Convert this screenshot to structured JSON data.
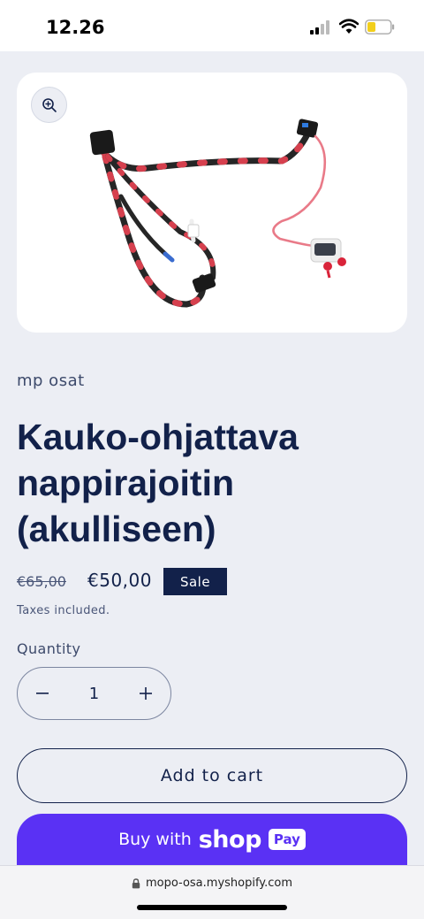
{
  "status_bar": {
    "time": "12.26",
    "icons": [
      "signal-icon",
      "wifi-icon",
      "battery-icon"
    ]
  },
  "product": {
    "image_alt": "Kauko-ohjattava nappirajoitin (akulliseen)",
    "zoom_icon": "zoom-in-icon",
    "vendor": "mp osat",
    "title": "Kauko-ohjattava nappirajoitin (akulliseen)",
    "price_compare": "€65,00",
    "price_sale": "€50,00",
    "sale_badge": "Sale",
    "taxes_note": "Taxes included."
  },
  "quantity": {
    "label": "Quantity",
    "minus": "−",
    "value": "1",
    "plus": "+"
  },
  "actions": {
    "add_to_cart": "Add to cart",
    "buy_with": "Buy with",
    "shop_word": "shop",
    "pay_chip": "Pay"
  },
  "browser": {
    "url": "mopo-osa.myshopify.com",
    "lock_icon": "lock-icon"
  },
  "colors": {
    "navy": "#12214a",
    "shop_pay_purple": "#5a31f4",
    "page_bg": "#eceef4"
  }
}
